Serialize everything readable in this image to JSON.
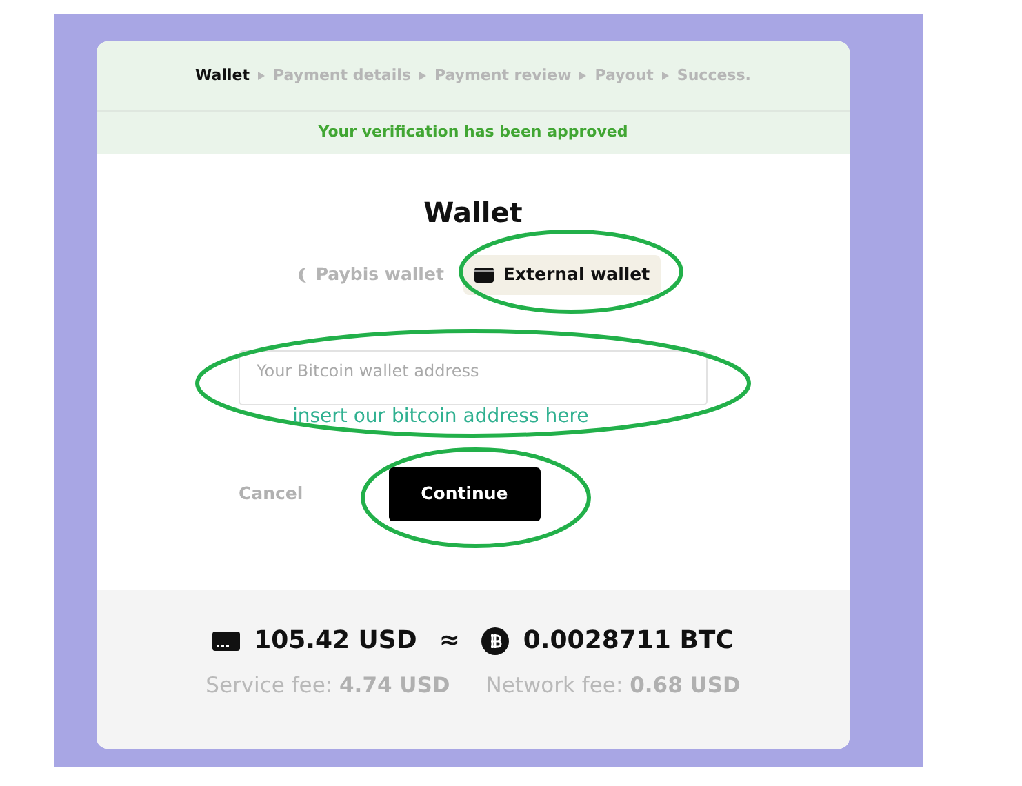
{
  "steps": [
    {
      "label": "Wallet",
      "selected": true
    },
    {
      "label": "Payment details",
      "selected": false
    },
    {
      "label": "Payment review",
      "selected": false
    },
    {
      "label": "Payout",
      "selected": false
    },
    {
      "label": "Success.",
      "selected": false
    }
  ],
  "notice": "Your verification has been approved",
  "title": "Wallet",
  "wallet_options": [
    {
      "label": "Paybis wallet",
      "selected": false
    },
    {
      "label": "External wallet",
      "selected": true
    }
  ],
  "address_field": {
    "placeholder": "Your Bitcoin wallet address"
  },
  "buttons": {
    "cancel": "Cancel",
    "continue": "Continue"
  },
  "summary": {
    "fiat": "105.42 USD",
    "approx": "≈",
    "crypto": "0.0028711 BTC",
    "service_fee": "Service fee: **4.74 USD**",
    "network_fee": "Network fee: **0.68 USD**"
  },
  "annotations": [
    {
      "kind": "ellipse"
    },
    {
      "kind": "ellipse"
    },
    {
      "kind": "ellipse"
    },
    {
      "kind": "text",
      "text": "insert our bitcoin address here"
    }
  ]
}
